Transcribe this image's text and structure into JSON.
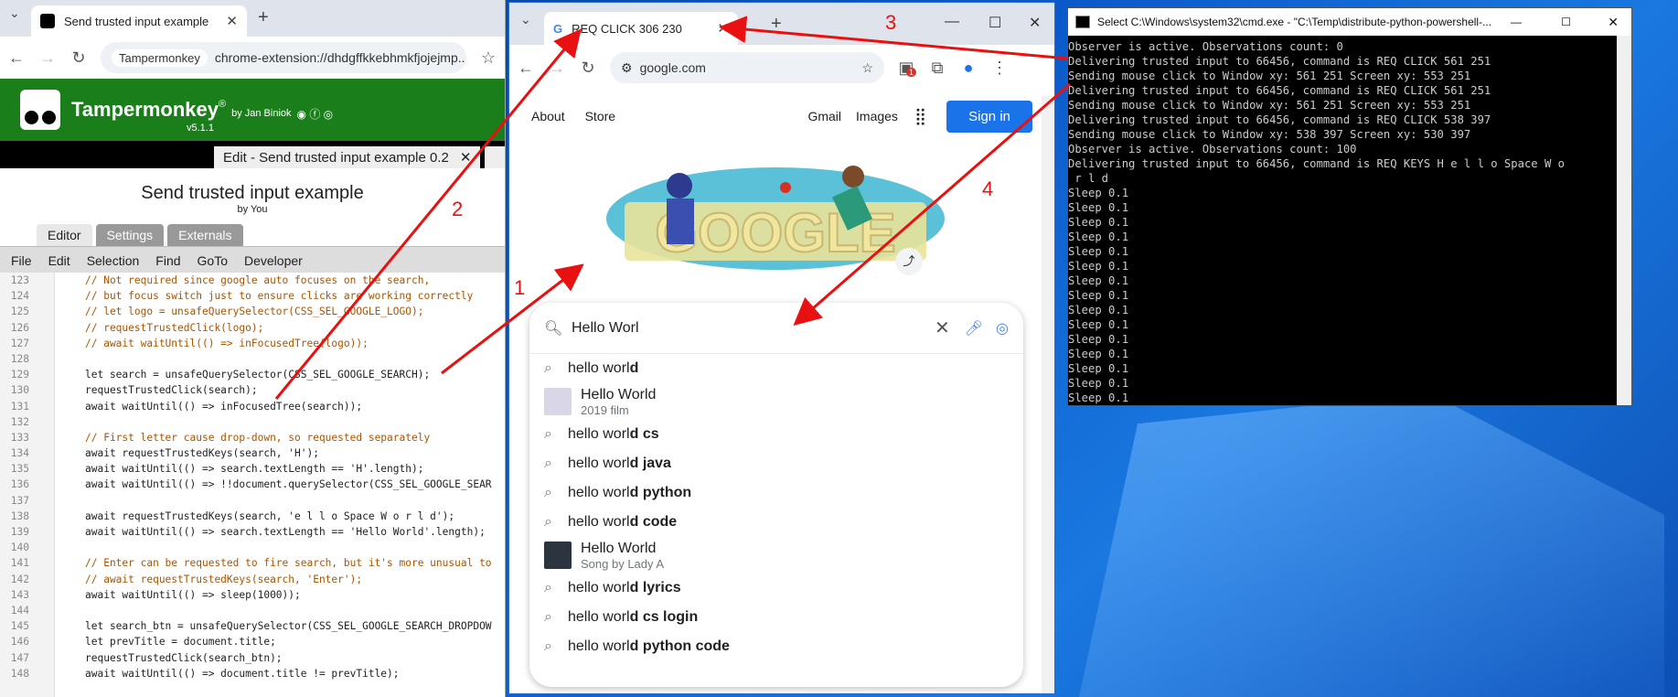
{
  "left_window": {
    "tab_title": "Send trusted input example",
    "address_chip": "Tampermonkey",
    "address_url": "chrome-extension://dhdgffkkebhmkfjojejmp...",
    "brand": "Tampermonkey",
    "brand_mark": "®",
    "byline": "by Jan Biniok",
    "version": "v5.1.1",
    "edit_tab": "Edit - Send trusted input example 0.2",
    "script_title": "Send trusted input example",
    "script_by": "by You",
    "subtabs": [
      "Editor",
      "Settings",
      "Externals"
    ],
    "menu": [
      "File",
      "Edit",
      "Selection",
      "Find",
      "GoTo",
      "Developer"
    ],
    "code_lines": [
      {
        "n": "123",
        "t": "// Not required since google auto focuses on the search,",
        "c": "cm"
      },
      {
        "n": "124",
        "t": "// but focus switch just to ensure clicks are working correctly",
        "c": "cm"
      },
      {
        "n": "125",
        "t": "// let logo = unsafeQuerySelector(CSS_SEL_GOOGLE_LOGO);",
        "c": "cm"
      },
      {
        "n": "126",
        "t": "// requestTrustedClick(logo);",
        "c": "cm"
      },
      {
        "n": "127",
        "t": "// await waitUntil(() => inFocusedTree(logo));",
        "c": "cm"
      },
      {
        "n": "128",
        "t": "",
        "c": ""
      },
      {
        "n": "129",
        "t": "let search = unsafeQuerySelector(CSS_SEL_GOOGLE_SEARCH);",
        "c": ""
      },
      {
        "n": "130",
        "t": "requestTrustedClick(search);",
        "c": ""
      },
      {
        "n": "131",
        "t": "await waitUntil(() => inFocusedTree(search));",
        "c": ""
      },
      {
        "n": "132",
        "t": "",
        "c": ""
      },
      {
        "n": "133",
        "t": "// First letter cause drop-down, so requested separately",
        "c": "cm"
      },
      {
        "n": "134",
        "t": "await requestTrustedKeys(search, 'H');",
        "c": ""
      },
      {
        "n": "135",
        "t": "await waitUntil(() => search.textLength == 'H'.length);",
        "c": ""
      },
      {
        "n": "136",
        "t": "await waitUntil(() => !!document.querySelector(CSS_SEL_GOOGLE_SEAR",
        "c": ""
      },
      {
        "n": "137",
        "t": "",
        "c": ""
      },
      {
        "n": "138",
        "t": "await requestTrustedKeys(search, 'e l l o Space W o r l d');",
        "c": ""
      },
      {
        "n": "139",
        "t": "await waitUntil(() => search.textLength == 'Hello World'.length);",
        "c": ""
      },
      {
        "n": "140",
        "t": "",
        "c": ""
      },
      {
        "n": "141",
        "t": "// Enter can be requested to fire search, but it's more unusual to",
        "c": "cm"
      },
      {
        "n": "142",
        "t": "// await requestTrustedKeys(search, 'Enter');",
        "c": "cm"
      },
      {
        "n": "143",
        "t": "await waitUntil(() => sleep(1000));",
        "c": ""
      },
      {
        "n": "144",
        "t": "",
        "c": ""
      },
      {
        "n": "145",
        "t": "let search_btn = unsafeQuerySelector(CSS_SEL_GOOGLE_SEARCH_DROPDOW",
        "c": ""
      },
      {
        "n": "146",
        "t": "let prevTitle = document.title;",
        "c": ""
      },
      {
        "n": "147",
        "t": "requestTrustedClick(search_btn);",
        "c": ""
      },
      {
        "n": "148",
        "t": "await waitUntil(() => document.title != prevTitle);",
        "c": ""
      }
    ]
  },
  "mid_window": {
    "tab_title": "REQ CLICK 306 230",
    "url": "google.com",
    "ext_badge": "1",
    "top_links": [
      "About",
      "Store",
      "Gmail",
      "Images"
    ],
    "sign_in": "Sign in",
    "search_value": "Hello Worl",
    "suggestions": [
      {
        "pre": "hello worl",
        "bold": "d",
        "sub": "",
        "thumb": false
      },
      {
        "pre": "Hello World",
        "bold": "",
        "sub": "2019 film",
        "thumb": true
      },
      {
        "pre": "hello worl",
        "bold": "d cs",
        "sub": "",
        "thumb": false
      },
      {
        "pre": "hello worl",
        "bold": "d java",
        "sub": "",
        "thumb": false
      },
      {
        "pre": "hello worl",
        "bold": "d python",
        "sub": "",
        "thumb": false
      },
      {
        "pre": "hello worl",
        "bold": "d code",
        "sub": "",
        "thumb": false
      },
      {
        "pre": "Hello World",
        "bold": "",
        "sub": "Song by Lady A",
        "thumb": true
      },
      {
        "pre": "hello worl",
        "bold": "d lyrics",
        "sub": "",
        "thumb": false
      },
      {
        "pre": "hello worl",
        "bold": "d cs login",
        "sub": "",
        "thumb": false
      },
      {
        "pre": "hello worl",
        "bold": "d python code",
        "sub": "",
        "thumb": false
      }
    ]
  },
  "cmd_window": {
    "title": "Select C:\\Windows\\system32\\cmd.exe - \"C:\\Temp\\distribute-python-powershell-...",
    "lines": [
      "Observer is active. Observations count: 0",
      "Delivering trusted input to 66456, command is REQ CLICK 561 251",
      "Sending mouse click to Window xy: 561 251 Screen xy: 553 251",
      "Delivering trusted input to 66456, command is REQ CLICK 561 251",
      "Sending mouse click to Window xy: 561 251 Screen xy: 553 251",
      "Delivering trusted input to 66456, command is REQ CLICK 538 397",
      "Sending mouse click to Window xy: 538 397 Screen xy: 530 397",
      "Observer is active. Observations count: 100",
      "Delivering trusted input to 66456, command is REQ KEYS H e l l o Space W o",
      " r l d",
      "Sleep 0.1",
      "Sleep 0.1",
      "Sleep 0.1",
      "Sleep 0.1",
      "Sleep 0.1",
      "Sleep 0.1",
      "Sleep 0.1",
      "Sleep 0.1",
      "Sleep 0.1",
      "Sleep 0.1",
      "Sleep 0.1",
      "Sleep 0.1",
      "Sleep 0.1",
      "Sleep 0.1",
      "Sleep 0.1"
    ]
  },
  "annotations": [
    "1",
    "2",
    "3",
    "4"
  ],
  "colors": {
    "annotation": "#e81010",
    "tm_green": "#1a7f1a",
    "google_blue": "#1a73e8"
  }
}
